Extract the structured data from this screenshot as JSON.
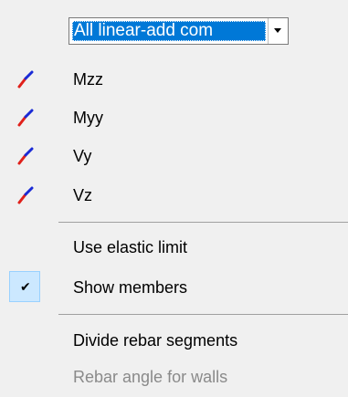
{
  "combo": {
    "value": "All linear-add com",
    "dropdown_icon": "chevron-down-icon"
  },
  "items": [
    {
      "label": "Mzz",
      "icon": "diagram-line-icon"
    },
    {
      "label": "Myy",
      "icon": "diagram-line-icon"
    },
    {
      "label": "Vy",
      "icon": "diagram-line-icon"
    },
    {
      "label": "Vz",
      "icon": "diagram-line-icon"
    }
  ],
  "options": [
    {
      "label": "Use elastic limit",
      "checked": false
    },
    {
      "label": "Show members",
      "checked": true
    }
  ],
  "actions": [
    {
      "label": "Divide rebar segments",
      "enabled": true
    },
    {
      "label": "Rebar angle for walls",
      "enabled": false
    }
  ],
  "colors": {
    "selection": "#0078d7",
    "check_highlight": "#cce8ff",
    "icon_red": "#e0201a",
    "icon_blue": "#1a2bd6",
    "disabled_text": "#8a8a8a"
  }
}
